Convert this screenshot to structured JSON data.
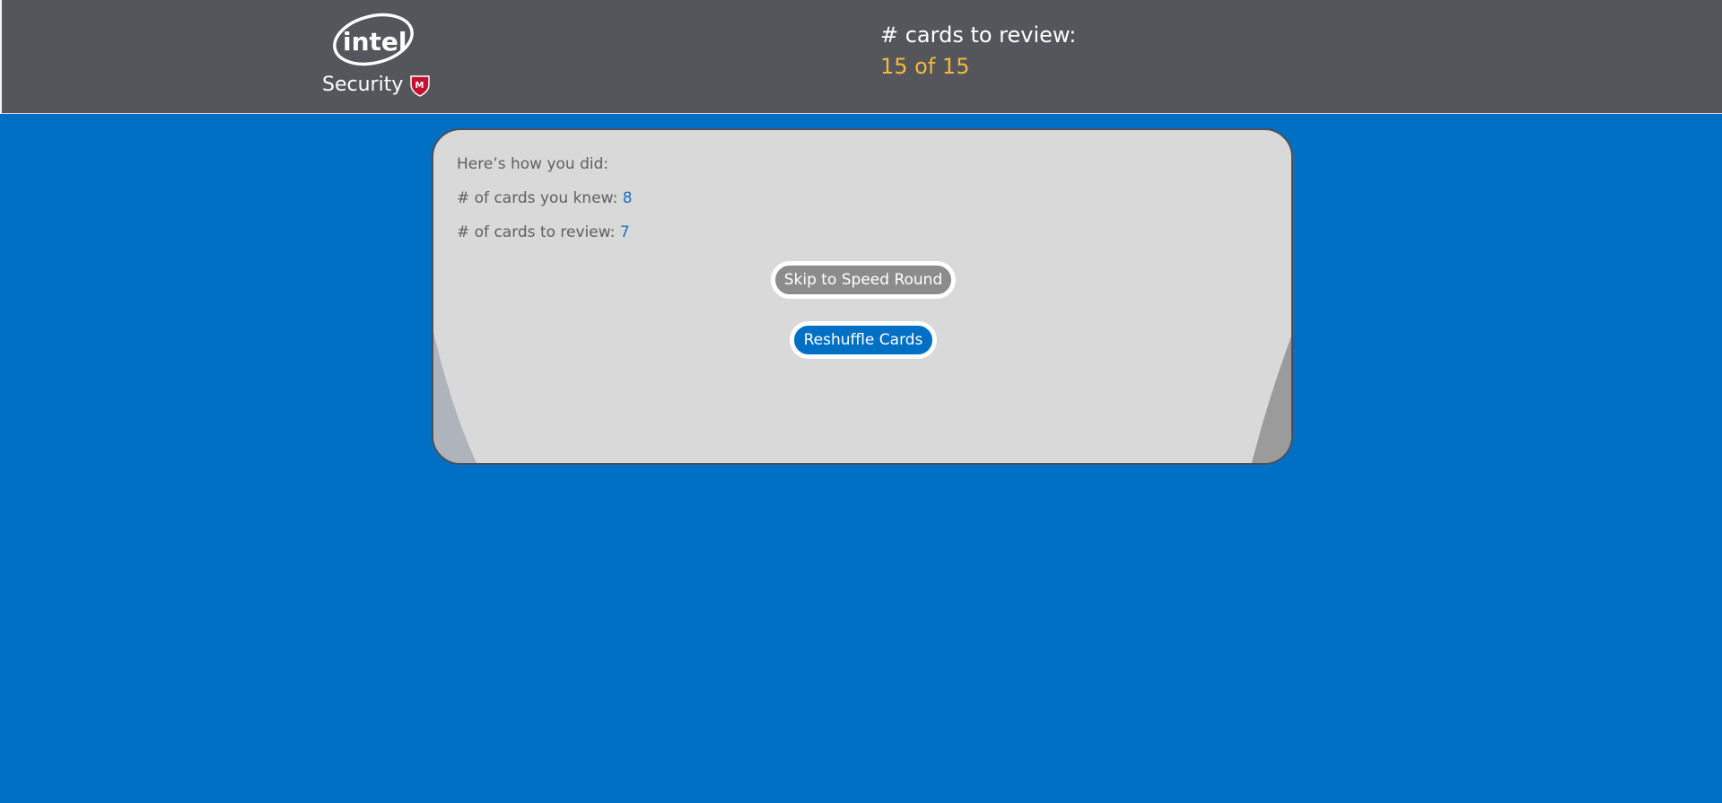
{
  "header": {
    "logo": {
      "brand_text": "intel",
      "sub_text": "Security",
      "badge_letter": "M"
    },
    "review_label": "# cards to review:",
    "review_count": "15 of 15"
  },
  "results": {
    "intro": "Here’s how you did:",
    "knew_label": "# of cards you knew: ",
    "knew_value": "8",
    "review_label": "# of cards to review: ",
    "review_value": "7"
  },
  "buttons": {
    "skip_label": "Skip to Speed Round",
    "reshuffle_label": "Reshuffle Cards"
  },
  "colors": {
    "background": "#0070c5",
    "header": "#54565b",
    "accent_orange": "#f4b93c",
    "card": "#d9d9d9"
  }
}
